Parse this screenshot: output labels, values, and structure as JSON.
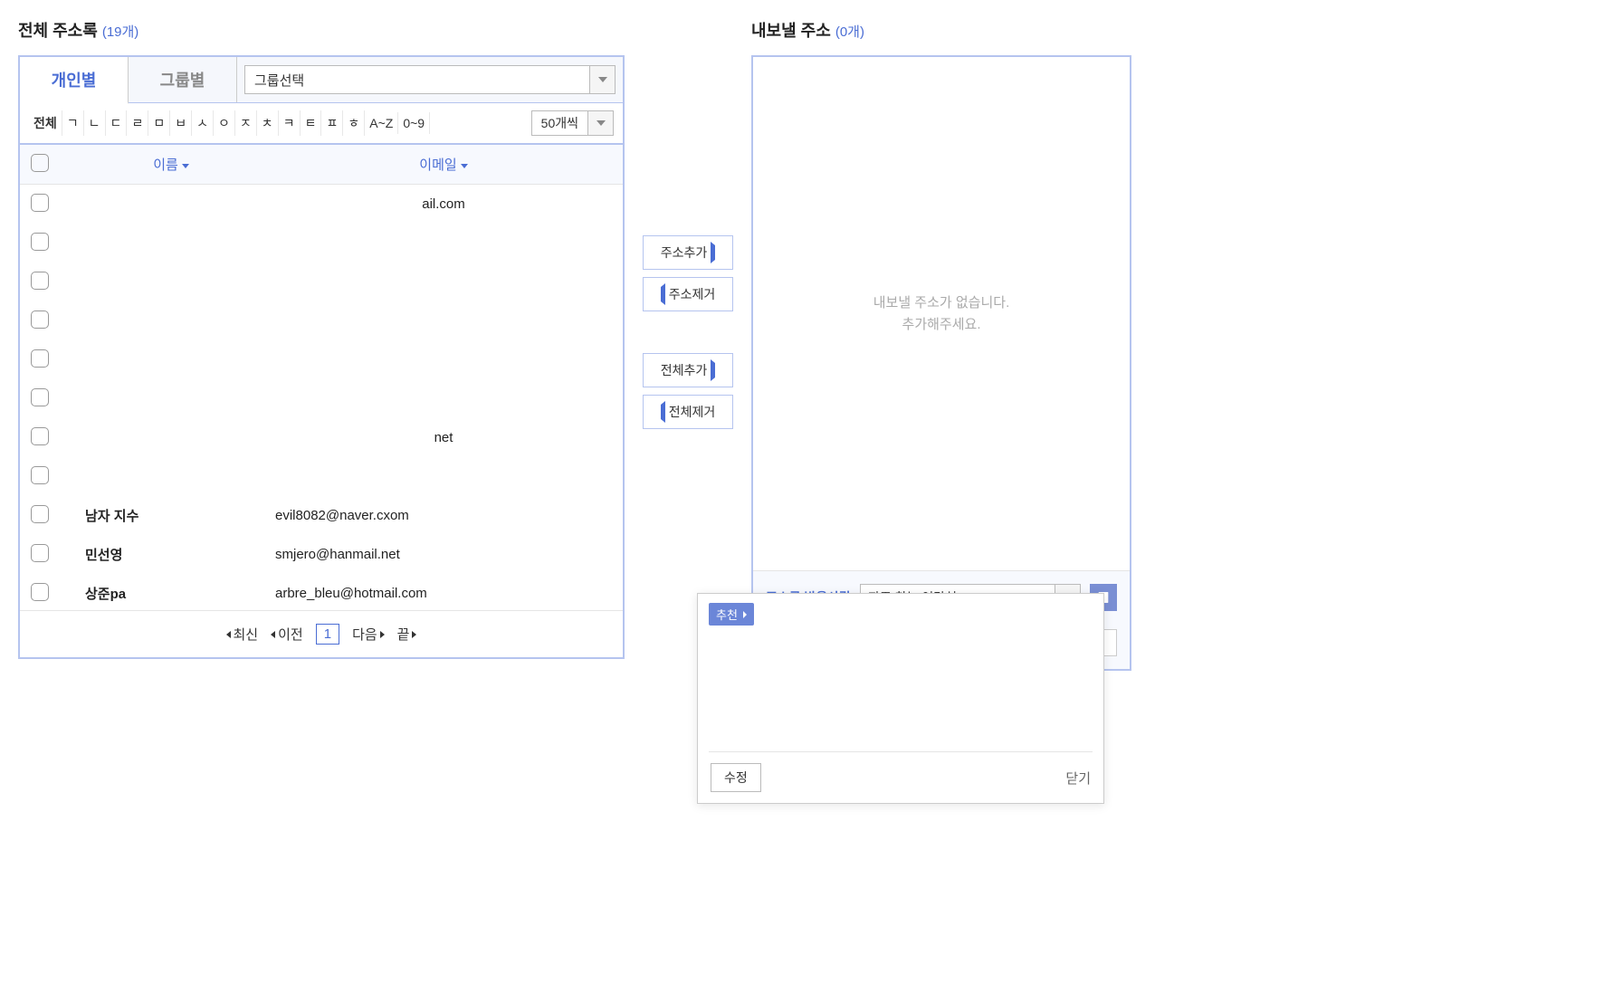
{
  "left": {
    "title": "전체 주소록",
    "count": "(19개)",
    "tabs": {
      "personal": "개인별",
      "group": "그룹별"
    },
    "groupSelect": "그룹선택",
    "filters": [
      "전체",
      "ㄱ",
      "ㄴ",
      "ㄷ",
      "ㄹ",
      "ㅁ",
      "ㅂ",
      "ㅅ",
      "ㅇ",
      "ㅈ",
      "ㅊ",
      "ㅋ",
      "ㅌ",
      "ㅍ",
      "ㅎ",
      "A~Z",
      "0~9"
    ],
    "pageSize": "50개씩",
    "columns": {
      "name": "이름",
      "email": "이메일"
    },
    "rows": [
      {
        "name": "",
        "email": "ail.com"
      },
      {
        "name": "",
        "email": ""
      },
      {
        "name": "",
        "email": ""
      },
      {
        "name": "",
        "email": ""
      },
      {
        "name": "",
        "email": ""
      },
      {
        "name": "",
        "email": ""
      },
      {
        "name": "",
        "email": "net"
      },
      {
        "name": "",
        "email": ""
      },
      {
        "name": "남자 지수",
        "email": "evil8082@naver.cxom"
      },
      {
        "name": "민선영",
        "email": "smjero@hanmail.net"
      },
      {
        "name": "상준pa",
        "email": "arbre_bleu@hotmail.com"
      }
    ],
    "pagination": {
      "first": "최신",
      "prev": "이전",
      "current": "1",
      "next": "다음",
      "last": "끝"
    }
  },
  "mid": {
    "addAddress": "주소추가",
    "removeAddress": "주소제거",
    "addAll": "전체추가",
    "removeAll": "전체제거"
  },
  "right": {
    "title": "내보낼 주소",
    "count": "(0개)",
    "emptyLine1": "내보낼 주소가 없습니다.",
    "emptyLine2": "추가해주세요.",
    "footerLabel": "주소록 받을사람",
    "footerSelect": "자주 찾는 연락처"
  },
  "popup": {
    "tag": "추천",
    "edit": "수정",
    "close": "닫기"
  }
}
